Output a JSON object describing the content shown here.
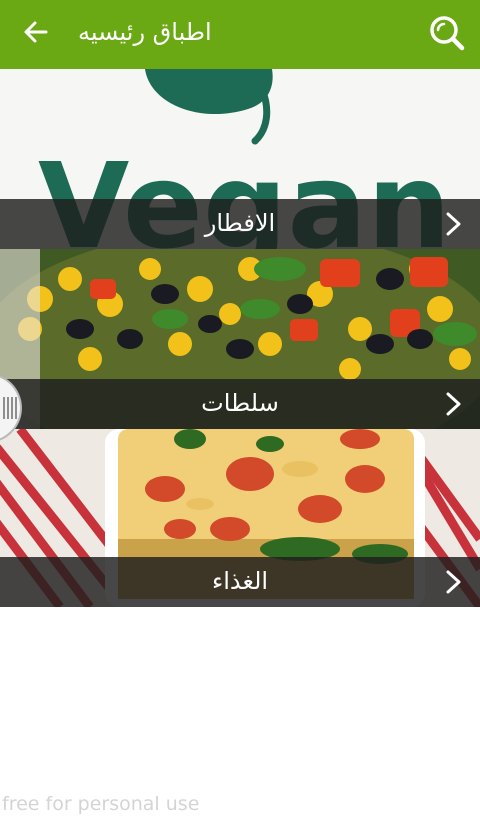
{
  "app_bar": {
    "title": "اطباق رئيسيه",
    "back_icon": "arrow-left-icon",
    "search_icon": "search-icon",
    "background_color": "#6aa814"
  },
  "categories": [
    {
      "label": "الافطار",
      "image": "vegan-logo-banner"
    },
    {
      "label": "سلطات",
      "image": "salad-photo"
    },
    {
      "label": "الغذاء",
      "image": "lasagna-photo"
    }
  ],
  "banner": {
    "text": "Vegan"
  },
  "watermark": "free for personal use"
}
